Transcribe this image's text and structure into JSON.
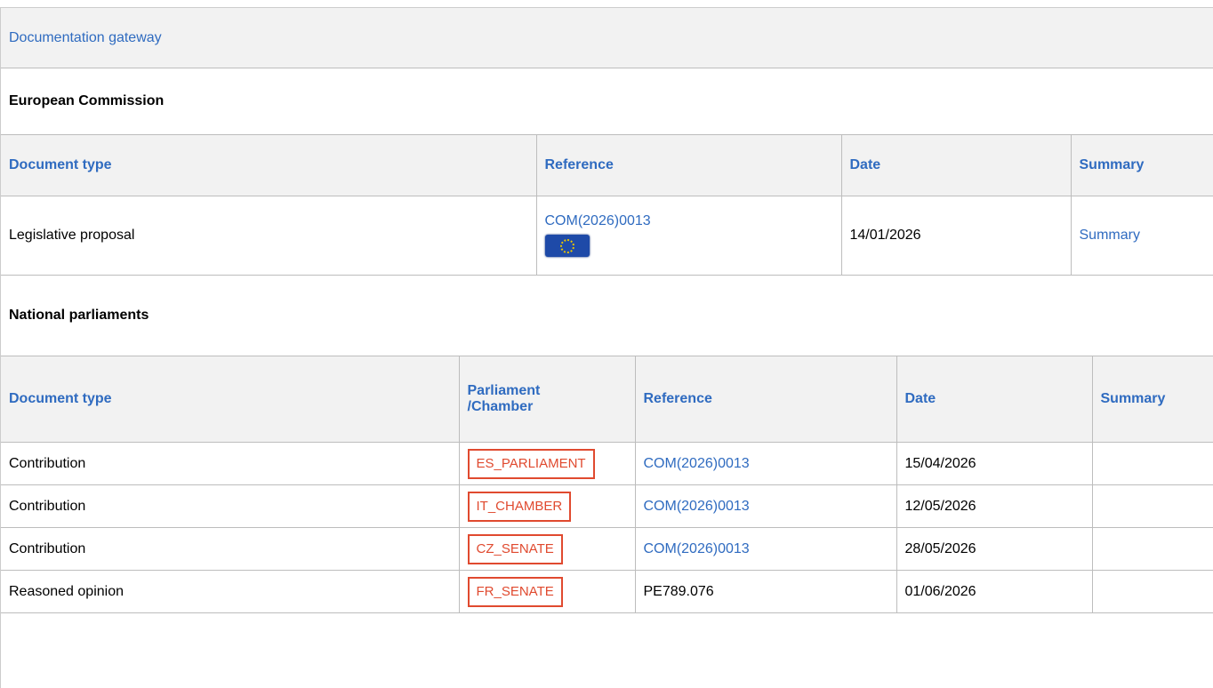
{
  "gateway": {
    "title": "Documentation gateway"
  },
  "commission": {
    "title": "European Commission",
    "columns": {
      "document_type": "Document type",
      "reference": "Reference",
      "date": "Date",
      "summary": "Summary"
    },
    "rows": [
      {
        "document_type": "Legislative proposal",
        "reference": "COM(2026)0013",
        "date": "14/01/2026",
        "summary": "Summary",
        "flag_icon": "eu-flag-icon"
      }
    ]
  },
  "national": {
    "title": "National parliaments",
    "columns": {
      "document_type": "Document type",
      "parliament": "Parliament /Chamber",
      "reference": "Reference",
      "date": "Date",
      "summary": "Summary"
    },
    "rows": [
      {
        "document_type": "Contribution",
        "parliament": "ES_PARLIAMENT",
        "reference": "COM(2026)0013",
        "reference_is_link": true,
        "date": "15/04/2026",
        "summary": ""
      },
      {
        "document_type": "Contribution",
        "parliament": "IT_CHAMBER",
        "reference": "COM(2026)0013",
        "reference_is_link": true,
        "date": "12/05/2026",
        "summary": ""
      },
      {
        "document_type": "Contribution",
        "parliament": "CZ_SENATE",
        "reference": "COM(2026)0013",
        "reference_is_link": true,
        "date": "28/05/2026",
        "summary": ""
      },
      {
        "document_type": "Reasoned opinion",
        "parliament": "FR_SENATE",
        "reference": "PE789.076",
        "reference_is_link": false,
        "date": "01/06/2026",
        "summary": ""
      }
    ]
  },
  "colors": {
    "link": "#2f6bc0",
    "tag": "#e04a2f",
    "header_bg": "#f2f2f2",
    "border": "#bdbdbd"
  }
}
